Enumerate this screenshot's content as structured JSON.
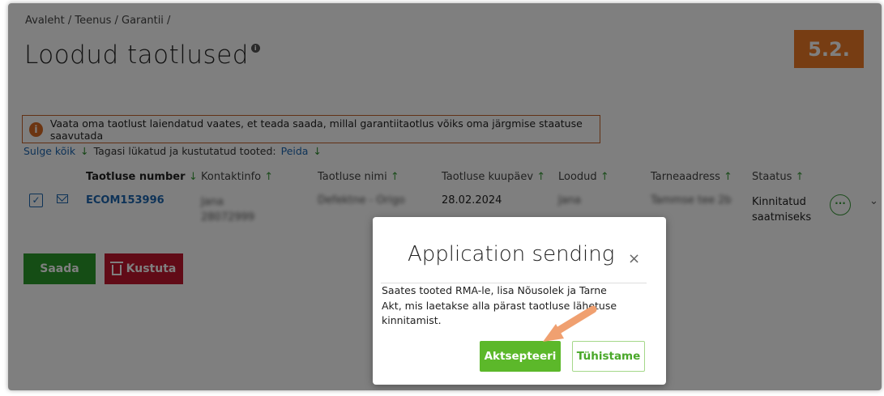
{
  "breadcrumb": "Avaleht / Teenus / Garantii /",
  "page_title": "Loodud taotlused",
  "step_badge": "5.2.",
  "alert": {
    "icon": "i",
    "text": "Vaata oma taotlust laiendatud vaates, et teada saada, millal garantiitaotlus võiks oma järgmise staatuse saavutada"
  },
  "filters": {
    "collapse_label": "Sulge kõik",
    "returned_label": "Tagasi lükatud ja kustutatud tooted:",
    "hide_link": "Peida"
  },
  "table": {
    "columns": [
      "Taotluse number",
      "Kontaktinfo",
      "Taotluse nimi",
      "Taotluse kuupäev",
      "Loodud",
      "Tarneaadress",
      "Staatus"
    ],
    "row": {
      "number": "ECOM153996",
      "contact_line1": "Jana",
      "contact_line2": "28072999",
      "name": "Defektne - Origo",
      "date": "28.02.2024",
      "created_by": "Jana",
      "address": "Tammse tee 2b",
      "status_line1": "Kinnitatud",
      "status_line2": "saatmiseks"
    }
  },
  "actions": {
    "send": "Saada",
    "delete": "Kustuta"
  },
  "modal": {
    "title": "Application sending",
    "close": "×",
    "body": "Saates tooted RMA-le, lisa Nõusolek ja Tarne Akt, mis laetakse alla pärast taotluse lähetuse kinnitamist.",
    "accept": "Aktsepteeri",
    "cancel": "Tühistame"
  },
  "colors": {
    "accent_orange": "#ef7b26",
    "green": "#2a9a2a",
    "red": "#c2162e",
    "link_blue": "#1d66b0"
  }
}
